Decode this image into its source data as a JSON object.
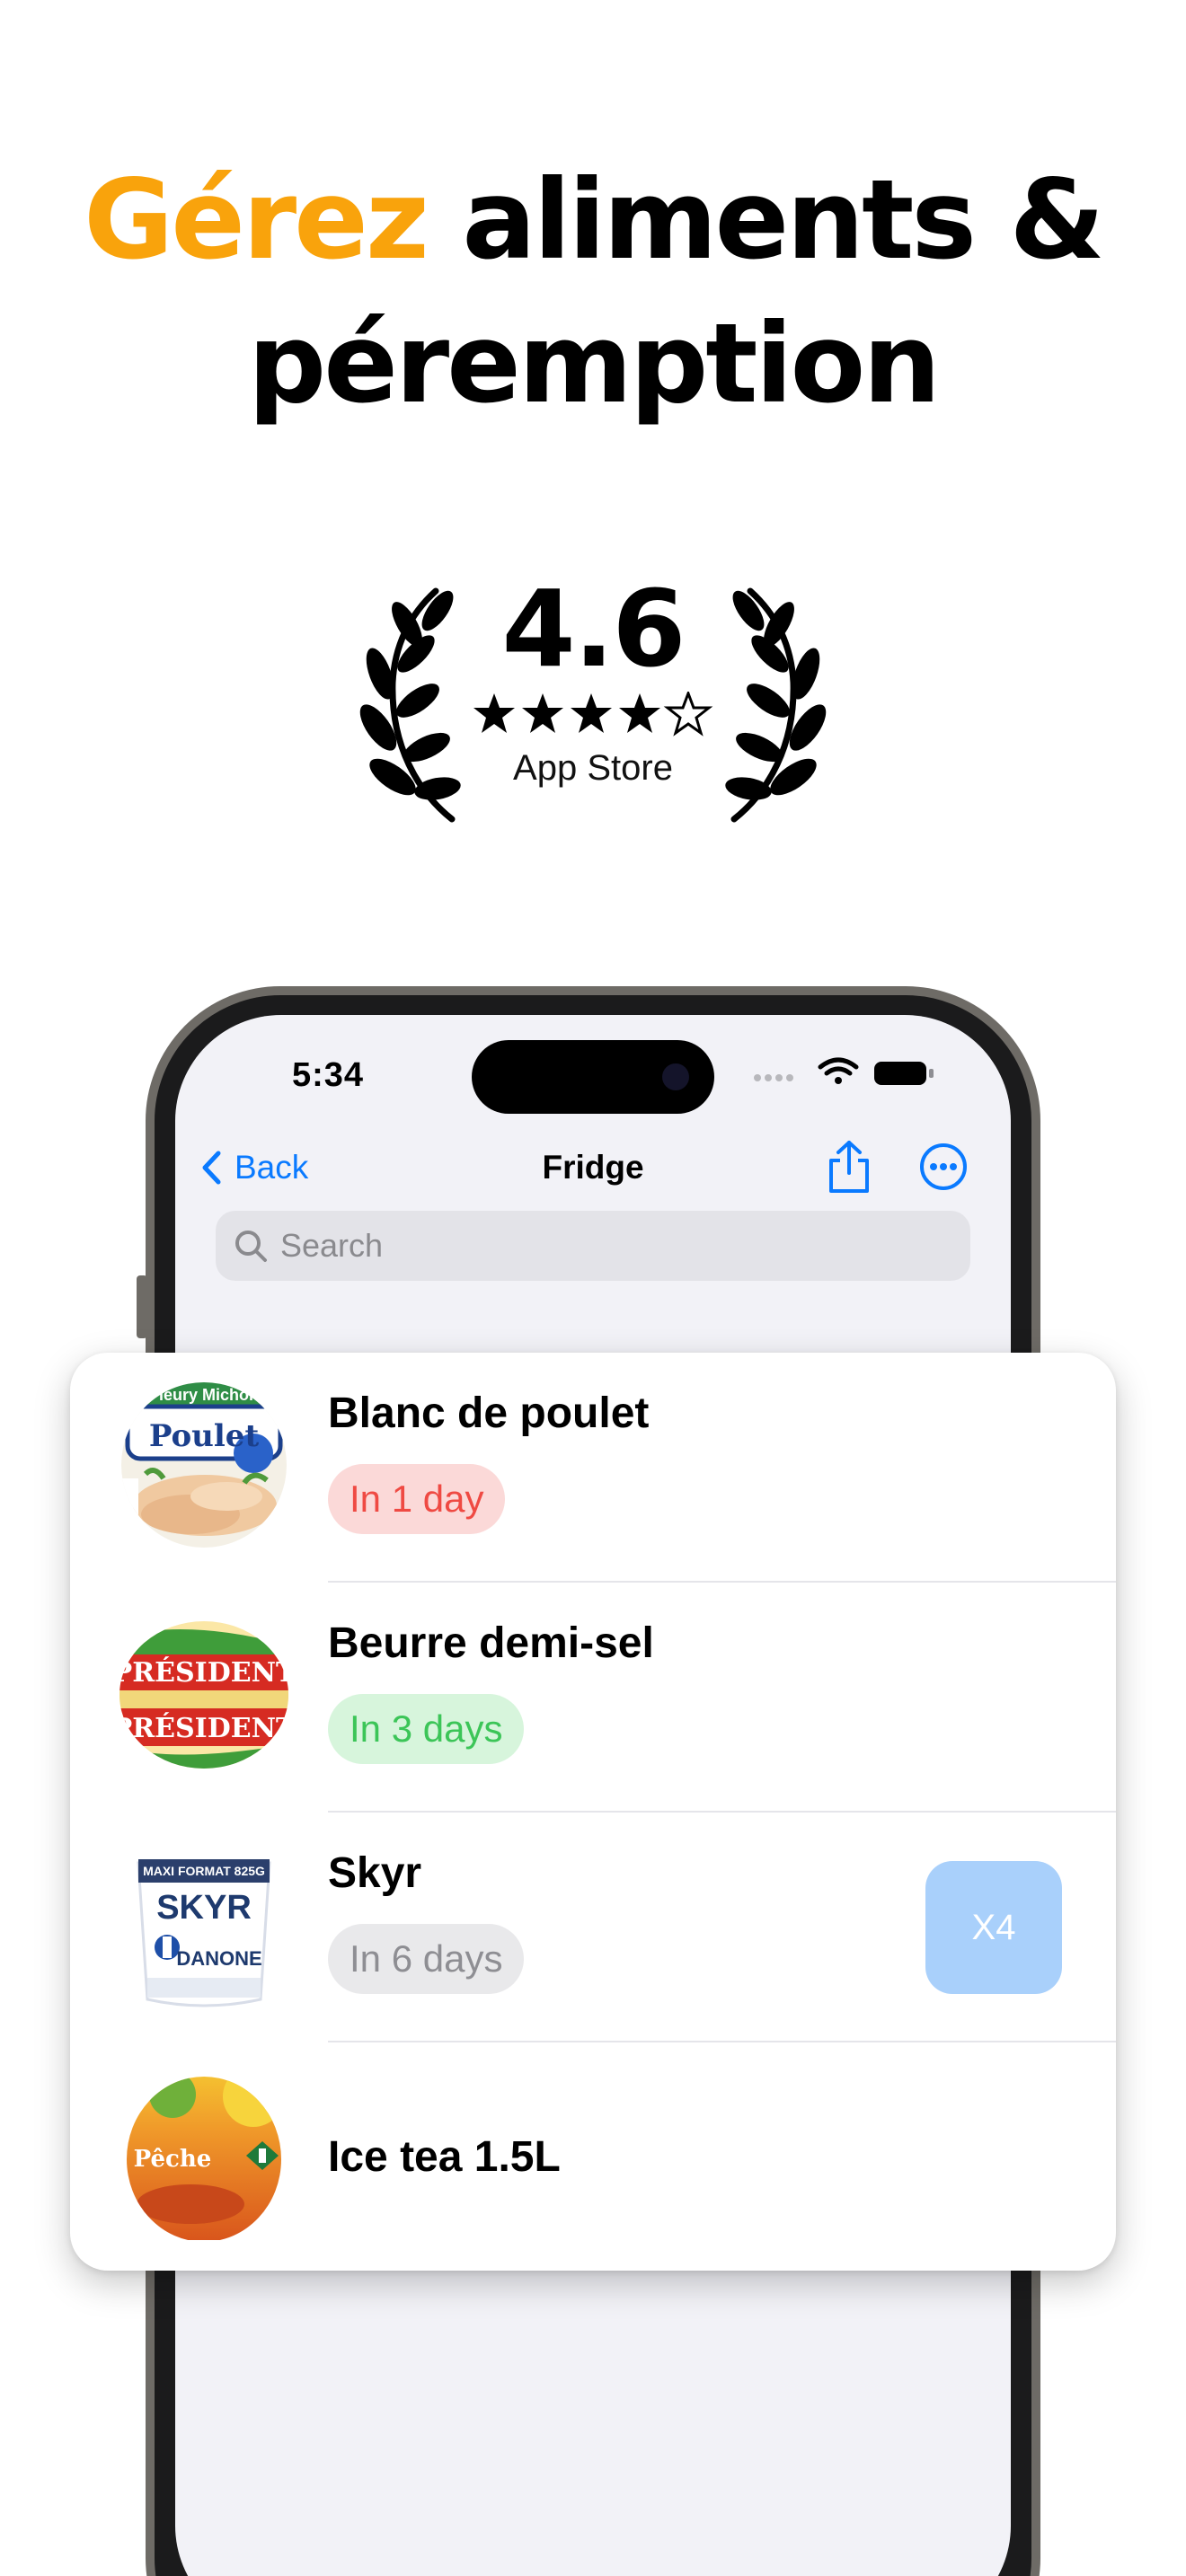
{
  "headline": {
    "accent": "Gérez",
    "rest_line1": " aliments &",
    "line2": "péremption"
  },
  "rating": {
    "value": "4.6",
    "stars": 4.5,
    "source": "App Store"
  },
  "status_bar": {
    "time": "5:34"
  },
  "nav": {
    "back_label": "Back",
    "title": "Fridge"
  },
  "search": {
    "placeholder": "Search"
  },
  "items": [
    {
      "name": "Blanc de poulet",
      "expiry": "In 1 day",
      "status": "red",
      "quantity": ""
    },
    {
      "name": "Beurre demi-sel",
      "expiry": "In 3 days",
      "status": "green",
      "quantity": ""
    },
    {
      "name": "Skyr",
      "expiry": "In 6 days",
      "status": "gray",
      "quantity": "X4"
    },
    {
      "name": "Ice tea 1.5L",
      "expiry": "",
      "status": "",
      "quantity": ""
    }
  ],
  "product_labels": {
    "poulet_brand": "Fleury Michon",
    "poulet_name": "Poulet",
    "beurre_brand": "PRÉSIDENT",
    "skyr_format": "MAXI FORMAT 825G",
    "skyr_name": "SKYR",
    "skyr_brand": "DANONE",
    "icetea_flavor": "Pêche"
  },
  "colors": {
    "accent": "#f9a30c",
    "ios_blue": "#0a7aff",
    "badge_red": "#ef4a43",
    "badge_green": "#3cc558",
    "badge_gray": "#8e8e93",
    "qty_bg": "#a9d0fb"
  },
  "icons": {
    "back": "chevron-left-icon",
    "share": "share-icon",
    "more": "ellipsis-circle-icon",
    "search": "magnifier-icon",
    "wifi": "wifi-icon",
    "battery": "battery-icon"
  }
}
